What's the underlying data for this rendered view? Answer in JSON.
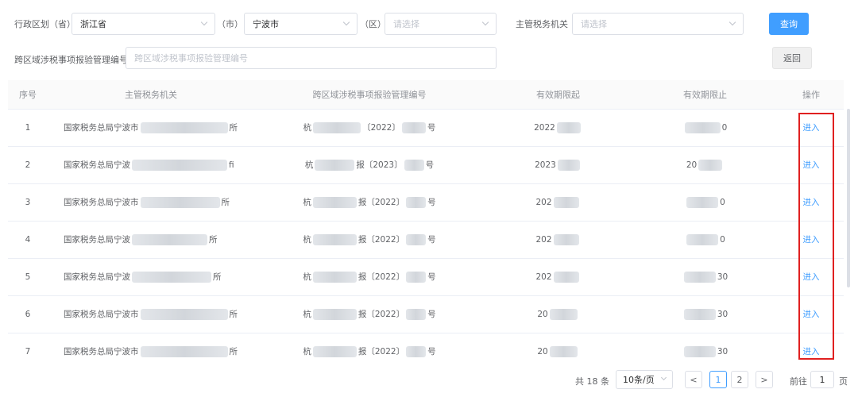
{
  "filters": {
    "province_label": "行政区划（省）",
    "province_value": "浙江省",
    "city_label": "（市）",
    "city_value": "宁波市",
    "district_label": "（区）",
    "district_placeholder": "请选择",
    "authority_label": "主管税务机关",
    "authority_placeholder": "请选择",
    "query_button": "查询",
    "code_label": "跨区域涉税事项报验管理编号",
    "code_placeholder": "跨区域涉税事项报验管理编号",
    "back_button": "返回"
  },
  "table": {
    "headers": [
      "序号",
      "主管税务机关",
      "跨区域涉税事项报验管理编号",
      "有效期限起",
      "有效期限止",
      "操作"
    ],
    "rows": [
      {
        "no": "1",
        "org_a": "国家税务总局宁波市",
        "org_b": "所",
        "code_a": "杭",
        "code_b": "〔2022〕",
        "code_c": "号",
        "start": "2022",
        "end": "0",
        "action": "进入"
      },
      {
        "no": "2",
        "org_a": "国家税务总局宁波",
        "org_b": "fi",
        "code_a": "杭",
        "code_b": "报〔2023〕",
        "code_c": "号",
        "start": "2023",
        "end": "20",
        "action": "进入"
      },
      {
        "no": "3",
        "org_a": "国家税务总局宁波市",
        "org_b": "所",
        "code_a": "杭",
        "code_b": "报〔2022〕",
        "code_c": "号",
        "start": "202",
        "end": "0",
        "action": "进入"
      },
      {
        "no": "4",
        "org_a": "国家税务总局宁波",
        "org_b": "所",
        "code_a": "杭",
        "code_b": "报〔2022〕",
        "code_c": "号",
        "start": "202",
        "end": "0",
        "action": "进入"
      },
      {
        "no": "5",
        "org_a": "国家税务总局宁波",
        "org_b": "所",
        "code_a": "杭",
        "code_b": "报〔2022〕",
        "code_c": "号",
        "start": "202",
        "end": "30",
        "action": "进入"
      },
      {
        "no": "6",
        "org_a": "国家税务总局宁波市",
        "org_b": "所",
        "code_a": "杭",
        "code_b": "报〔2022〕",
        "code_c": "号",
        "start": "20",
        "end": "30",
        "action": "进入"
      },
      {
        "no": "7",
        "org_a": "国家税务总局宁波市",
        "org_b": "所",
        "code_a": "杭",
        "code_b": "报〔2022〕",
        "code_c": "号",
        "start": "20",
        "end": "30",
        "action": "进入"
      }
    ]
  },
  "pagination": {
    "total": "共 18 条",
    "page_size": "10条/页",
    "prev": "<",
    "page1": "1",
    "page2": "2",
    "next": ">",
    "goto_label": "前往",
    "goto_value": "1",
    "page_suffix": "页"
  },
  "colors": {
    "primary": "#409eff",
    "highlight_box": "#e02020"
  }
}
